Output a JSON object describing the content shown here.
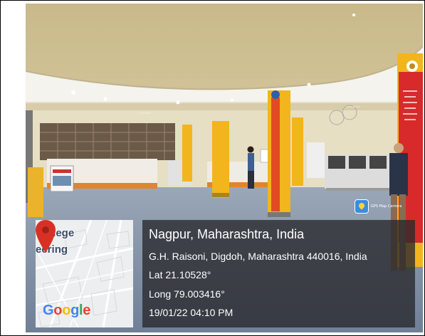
{
  "location": {
    "place": "Nagpur, Maharashtra, India",
    "address": "G.H. Raisoni, Digdoh, Maharashtra 440016, India",
    "latitude": "Lat 21.10528°",
    "longitude": "Long 79.003416°",
    "datetime": "19/01/22 04:10 PM"
  },
  "map": {
    "label_line1": "College",
    "label_line2": "eering",
    "provider": "Google",
    "pin_color": "#d93025",
    "icon": "map-pin-icon"
  },
  "watermark": {
    "app": "GPS Map Camera",
    "icon": "gps-map-camera-icon"
  },
  "colors": {
    "overlay": "#28282c",
    "pillar_yellow": "#f2b51c",
    "banner_red": "#d82a2a"
  }
}
